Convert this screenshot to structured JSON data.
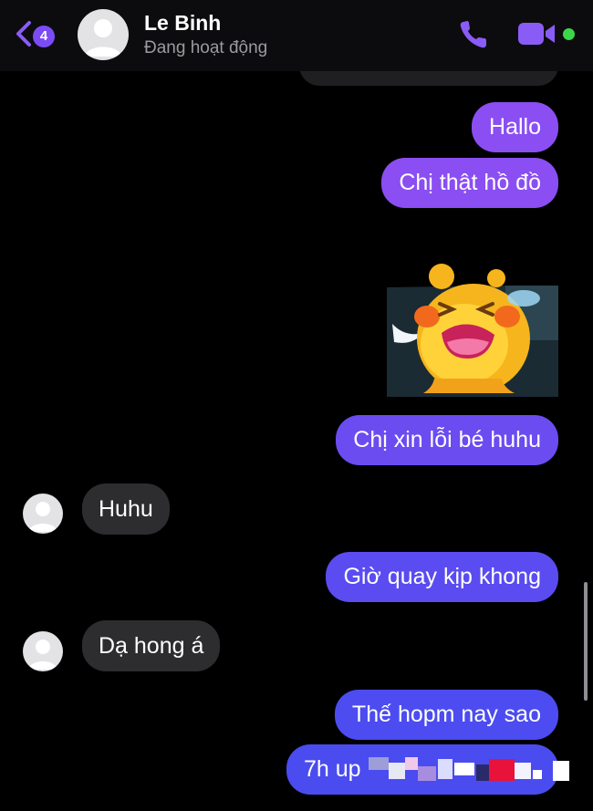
{
  "header": {
    "unread_count": "4",
    "contact_name": "Le Binh",
    "status": "Đang hoạt động"
  },
  "messages": [
    {
      "id": "m1",
      "sender": "me",
      "type": "text",
      "text": "Hallo"
    },
    {
      "id": "m2",
      "sender": "me",
      "type": "text",
      "text": "Chị thật hồ đồ"
    },
    {
      "id": "m3",
      "sender": "me",
      "type": "sticker",
      "sticker": "crying-yellow-mascot"
    },
    {
      "id": "m4",
      "sender": "me",
      "type": "text",
      "text": "Chị xin lỗi bé huhu"
    },
    {
      "id": "m5",
      "sender": "contact",
      "type": "text",
      "text": "Huhu"
    },
    {
      "id": "m6",
      "sender": "me",
      "type": "text",
      "text": "Giờ quay kịp khong"
    },
    {
      "id": "m7",
      "sender": "contact",
      "type": "text",
      "text": "Dạ hong á"
    },
    {
      "id": "m8",
      "sender": "me",
      "type": "text",
      "text": "Thế hopm nay sao"
    },
    {
      "id": "m9",
      "sender": "me",
      "type": "text",
      "text": "7h up",
      "partially_obscured": true
    }
  ],
  "icons": {
    "back": "chevron-left-icon",
    "call": "phone-icon",
    "video": "video-camera-icon",
    "online": "online-status-dot"
  },
  "colors": {
    "accent": "#7b4cf5",
    "bubble_top": "#8b4ef2",
    "bubble_bottom": "#4a4cf0",
    "incoming_bubble": "#2d2d30",
    "online": "#3cd64a",
    "background": "#000000"
  }
}
